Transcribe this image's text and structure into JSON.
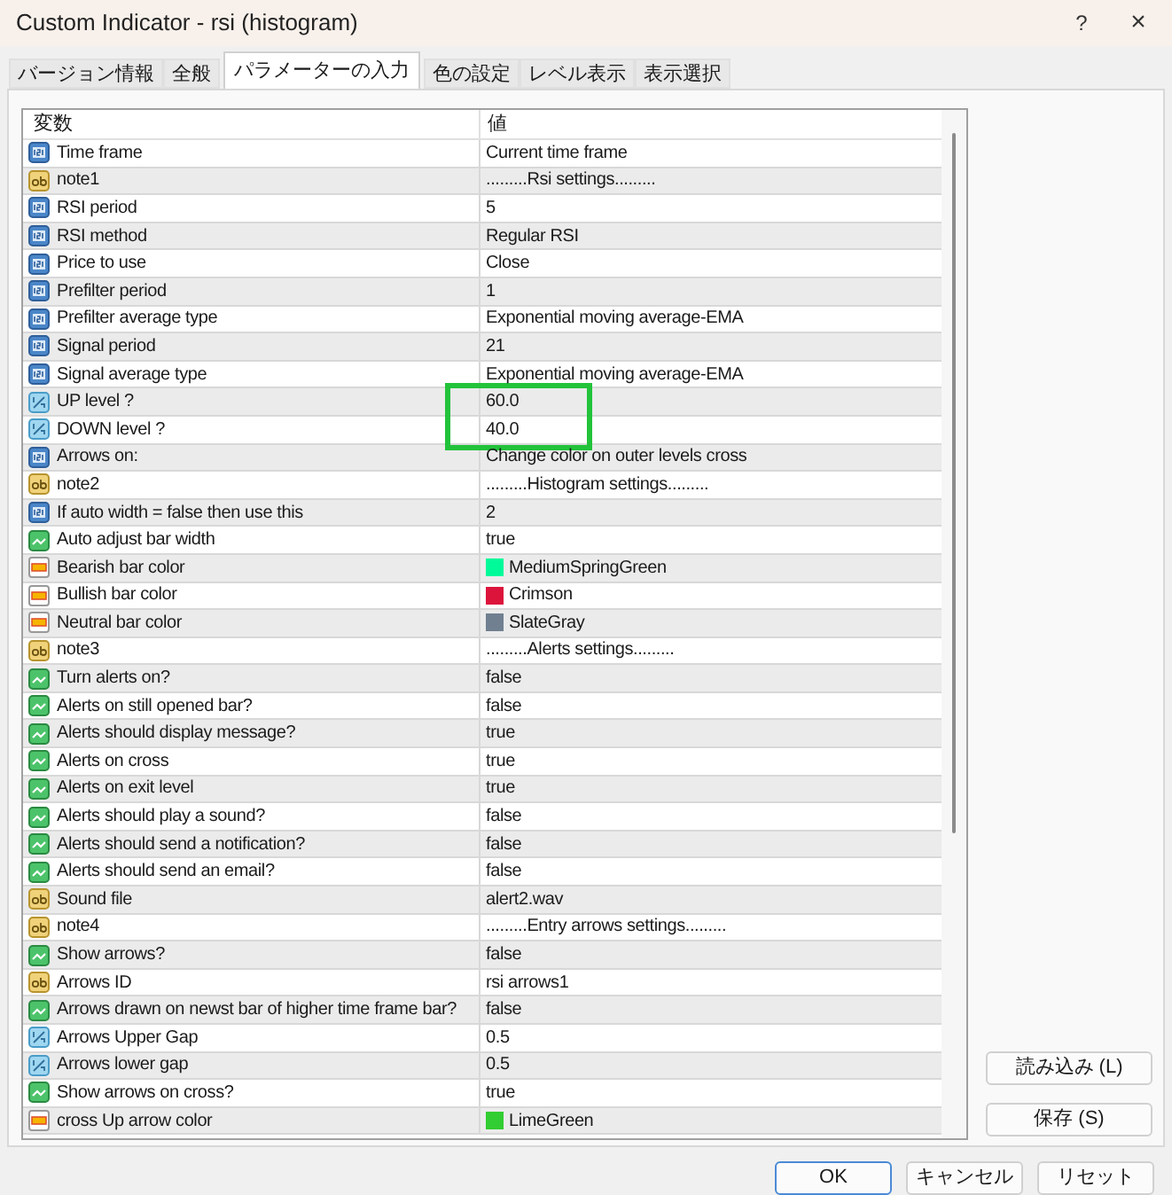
{
  "window": {
    "title": "Custom Indicator - rsi (histogram)",
    "help": "?",
    "close": "×"
  },
  "tabs": [
    {
      "label": "バージョン情報",
      "selected": false
    },
    {
      "label": "全般",
      "selected": false
    },
    {
      "label": "パラメーターの入力",
      "selected": true
    },
    {
      "label": "色の設定",
      "selected": false
    },
    {
      "label": "レベル表示",
      "selected": false
    },
    {
      "label": "表示選択",
      "selected": false
    }
  ],
  "table": {
    "columns": [
      "変数",
      "値"
    ],
    "rows": [
      {
        "kind": "int",
        "name": "Time frame",
        "value": "Current time frame"
      },
      {
        "kind": "string",
        "name": "note1",
        "value": ".........Rsi settings........."
      },
      {
        "kind": "int",
        "name": "RSI period",
        "value": "5"
      },
      {
        "kind": "int",
        "name": "RSI method",
        "value": "Regular RSI"
      },
      {
        "kind": "int",
        "name": "Price to use",
        "value": "Close"
      },
      {
        "kind": "int",
        "name": "Prefilter period",
        "value": "1"
      },
      {
        "kind": "int",
        "name": "Prefilter average type",
        "value": "Exponential moving average-EMA"
      },
      {
        "kind": "int",
        "name": "Signal period",
        "value": "21"
      },
      {
        "kind": "int",
        "name": "Signal average type",
        "value": "Exponential moving average-EMA"
      },
      {
        "kind": "double",
        "name": "UP level ?",
        "value": "60.0",
        "highlighted": true
      },
      {
        "kind": "double",
        "name": "DOWN level ?",
        "value": "40.0",
        "highlighted": true
      },
      {
        "kind": "int",
        "name": "Arrows on:",
        "value": "Change color on outer levels cross"
      },
      {
        "kind": "string",
        "name": "note2",
        "value": ".........Histogram settings........."
      },
      {
        "kind": "int",
        "name": "If auto width = false then use this",
        "value": "2"
      },
      {
        "kind": "bool",
        "name": "Auto adjust bar width",
        "value": "true"
      },
      {
        "kind": "color",
        "name": "Bearish bar color",
        "value": "MediumSpringGreen",
        "color": "#00fa9a"
      },
      {
        "kind": "color",
        "name": "Bullish bar color",
        "value": "Crimson",
        "color": "#dc143c"
      },
      {
        "kind": "color",
        "name": "Neutral bar color",
        "value": "SlateGray",
        "color": "#708090"
      },
      {
        "kind": "string",
        "name": "note3",
        "value": ".........Alerts settings........."
      },
      {
        "kind": "bool",
        "name": "Turn alerts on?",
        "value": "false"
      },
      {
        "kind": "bool",
        "name": "Alerts on still opened bar?",
        "value": "false"
      },
      {
        "kind": "bool",
        "name": "Alerts should display message?",
        "value": "true"
      },
      {
        "kind": "bool",
        "name": "Alerts on  cross",
        "value": "true"
      },
      {
        "kind": "bool",
        "name": "Alerts on exit level",
        "value": "true"
      },
      {
        "kind": "bool",
        "name": "Alerts should play a sound?",
        "value": "false"
      },
      {
        "kind": "bool",
        "name": "Alerts should send a notification?",
        "value": "false"
      },
      {
        "kind": "bool",
        "name": "Alerts should send an email?",
        "value": "false"
      },
      {
        "kind": "string",
        "name": "Sound file",
        "value": "alert2.wav"
      },
      {
        "kind": "string",
        "name": "note4",
        "value": ".........Entry arrows settings........."
      },
      {
        "kind": "bool",
        "name": "Show arrows?",
        "value": "false"
      },
      {
        "kind": "string",
        "name": "Arrows ID",
        "value": "rsi arrows1"
      },
      {
        "kind": "bool",
        "name": "Arrows drawn on newst bar of higher time frame bar?",
        "value": "false"
      },
      {
        "kind": "double",
        "name": "Arrows Upper Gap",
        "value": "0.5"
      },
      {
        "kind": "double",
        "name": "Arrows lower gap",
        "value": "0.5"
      },
      {
        "kind": "bool",
        "name": "Show arrows on  cross?",
        "value": "true"
      },
      {
        "kind": "color",
        "name": "cross Up arrow color",
        "value": "LimeGreen",
        "color": "#32cd32"
      }
    ]
  },
  "side_buttons": [
    "読み込み (L)",
    "保存 (S)"
  ],
  "buttons": [
    "OK",
    "キャンセル",
    "リセット"
  ]
}
